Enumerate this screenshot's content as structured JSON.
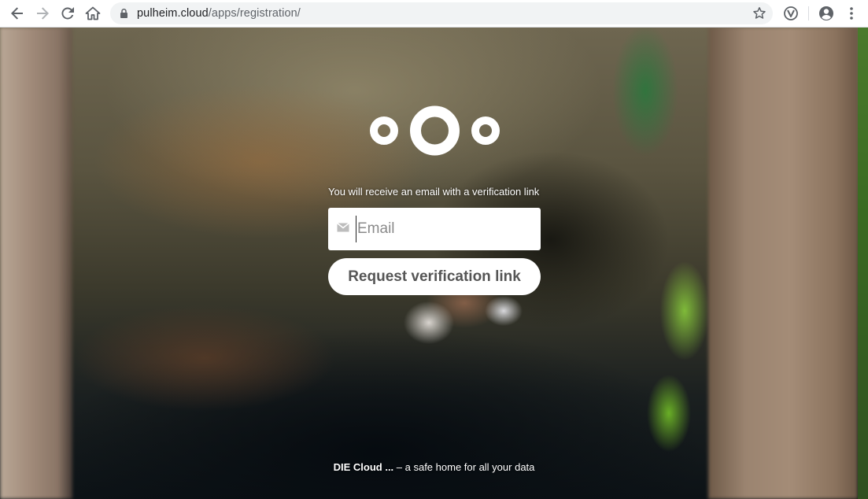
{
  "browser": {
    "url_host": "pulheim.cloud",
    "url_path": "/apps/registration/",
    "icons": {
      "back": "arrow-back-icon",
      "forward": "arrow-forward-icon",
      "reload": "reload-icon",
      "home": "home-icon",
      "lock": "lock-icon",
      "bookmark": "star-icon",
      "extension": "vivaldi-extension-icon",
      "profile": "account-circle-icon",
      "menu": "kebab-menu-icon"
    }
  },
  "registration": {
    "info_text": "You will receive an email with a verification link",
    "email_placeholder": "Email",
    "email_value": "",
    "submit_label": "Request verification link"
  },
  "footer": {
    "brand": "DIE Cloud ...",
    "tagline": " – a safe home for all your data"
  },
  "colors": {
    "accent_white": "#ffffff",
    "button_text": "#555555",
    "omnibox_bg": "#f1f3f4"
  }
}
